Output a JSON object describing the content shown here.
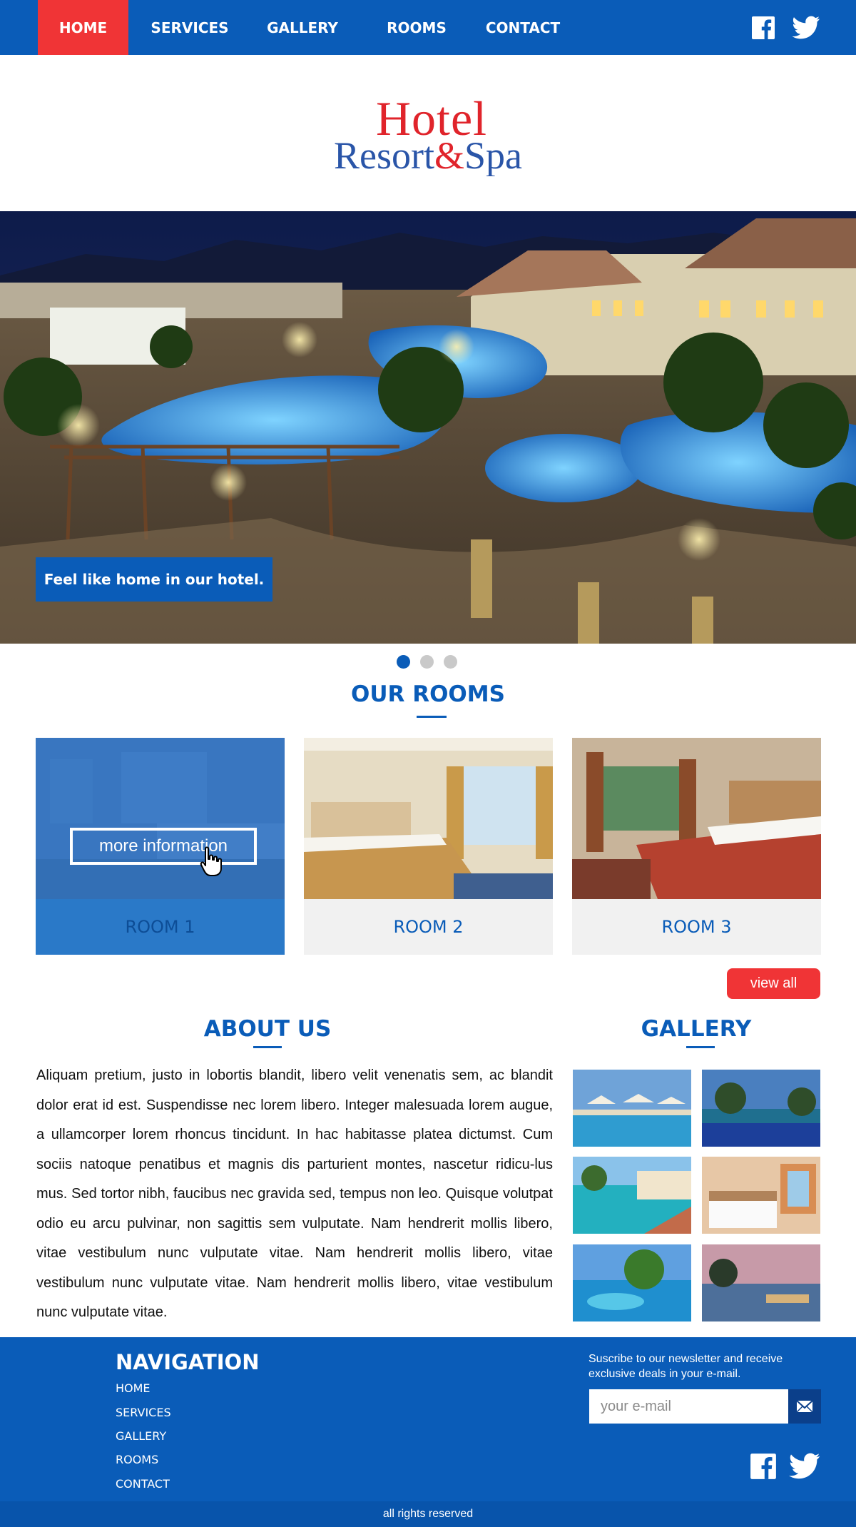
{
  "nav": {
    "items": [
      "HOME",
      "SERVICES",
      "GALLERY",
      "ROOMS",
      "CONTACT"
    ],
    "active": "HOME",
    "social_icons": [
      "facebook-icon",
      "twitter-icon"
    ]
  },
  "logo": {
    "line1": "Hotel",
    "line2a": "Resort",
    "amp": "&",
    "line2b": "Spa"
  },
  "hero": {
    "caption": "Feel like home in our hotel.",
    "slides": 3,
    "active_slide": 1
  },
  "rooms": {
    "title": "OUR ROOMS",
    "items": [
      {
        "label": "ROOM 1",
        "hover_button": "more information"
      },
      {
        "label": "ROOM 2"
      },
      {
        "label": "ROOM 3"
      }
    ],
    "view_all": "view all"
  },
  "about": {
    "title": "ABOUT US",
    "text": "Aliquam pretium, justo in lobortis blandit, libero velit venenatis sem, ac blandit dolor erat id est. Suspendisse nec lorem libero. Integer malesuada lorem augue, a ullamcorper lorem rhoncus tincidunt. In hac habitasse platea dictumst. Cum sociis natoque penatibus et magnis dis parturient montes, nascetur ridicu-lus mus. Sed tortor nibh, faucibus nec gravida sed, tempus non leo. Quisque volutpat odio eu arcu pulvinar, non sagittis sem vulputate. Nam hendrerit mollis libero, vitae vestibulum nunc vulputate vitae. Nam hendrerit mollis libero, vitae vestibulum nunc vulputate vitae. Nam hendrerit mollis libero, vitae vestibulum nunc vulputate vitae."
  },
  "gallery": {
    "title": "GALLERY",
    "thumb_count": 6
  },
  "footer": {
    "nav_title": "NAVIGATION",
    "links": [
      "HOME",
      "SERVICES",
      "GALLERY",
      "ROOMS",
      "CONTACT"
    ],
    "newsletter_text": "Suscribe to our newsletter and receive exclusive deals in your e-mail.",
    "email_placeholder": "your e-mail",
    "copyright": "all rights reserved"
  },
  "colors": {
    "brand_blue": "#0a5cb8",
    "accent_red": "#f03436",
    "light_grey": "#f1f1f1"
  }
}
